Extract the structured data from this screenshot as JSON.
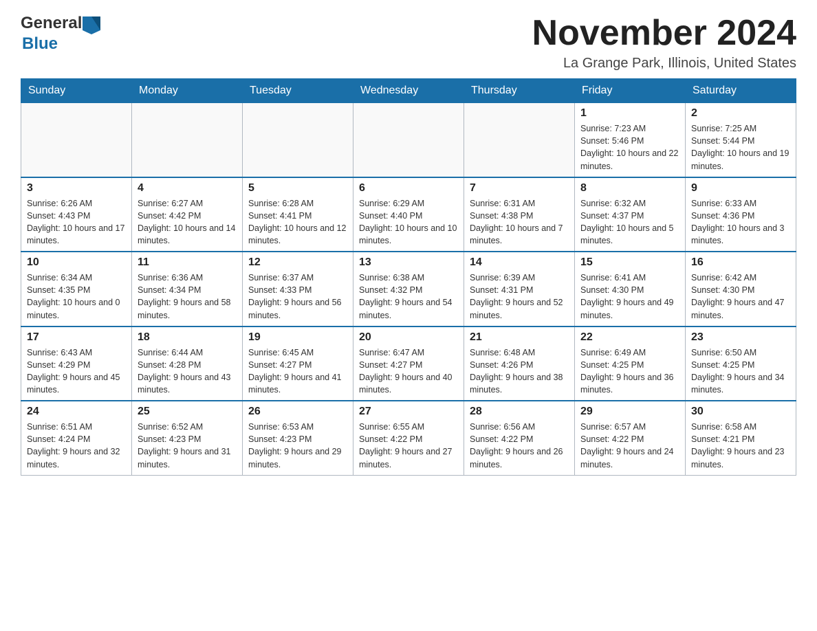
{
  "header": {
    "logo_general": "General",
    "logo_blue": "Blue",
    "month_title": "November 2024",
    "location": "La Grange Park, Illinois, United States"
  },
  "weekdays": [
    "Sunday",
    "Monday",
    "Tuesday",
    "Wednesday",
    "Thursday",
    "Friday",
    "Saturday"
  ],
  "weeks": [
    {
      "days": [
        {
          "num": "",
          "info": ""
        },
        {
          "num": "",
          "info": ""
        },
        {
          "num": "",
          "info": ""
        },
        {
          "num": "",
          "info": ""
        },
        {
          "num": "",
          "info": ""
        },
        {
          "num": "1",
          "info": "Sunrise: 7:23 AM\nSunset: 5:46 PM\nDaylight: 10 hours and 22 minutes."
        },
        {
          "num": "2",
          "info": "Sunrise: 7:25 AM\nSunset: 5:44 PM\nDaylight: 10 hours and 19 minutes."
        }
      ]
    },
    {
      "days": [
        {
          "num": "3",
          "info": "Sunrise: 6:26 AM\nSunset: 4:43 PM\nDaylight: 10 hours and 17 minutes."
        },
        {
          "num": "4",
          "info": "Sunrise: 6:27 AM\nSunset: 4:42 PM\nDaylight: 10 hours and 14 minutes."
        },
        {
          "num": "5",
          "info": "Sunrise: 6:28 AM\nSunset: 4:41 PM\nDaylight: 10 hours and 12 minutes."
        },
        {
          "num": "6",
          "info": "Sunrise: 6:29 AM\nSunset: 4:40 PM\nDaylight: 10 hours and 10 minutes."
        },
        {
          "num": "7",
          "info": "Sunrise: 6:31 AM\nSunset: 4:38 PM\nDaylight: 10 hours and 7 minutes."
        },
        {
          "num": "8",
          "info": "Sunrise: 6:32 AM\nSunset: 4:37 PM\nDaylight: 10 hours and 5 minutes."
        },
        {
          "num": "9",
          "info": "Sunrise: 6:33 AM\nSunset: 4:36 PM\nDaylight: 10 hours and 3 minutes."
        }
      ]
    },
    {
      "days": [
        {
          "num": "10",
          "info": "Sunrise: 6:34 AM\nSunset: 4:35 PM\nDaylight: 10 hours and 0 minutes."
        },
        {
          "num": "11",
          "info": "Sunrise: 6:36 AM\nSunset: 4:34 PM\nDaylight: 9 hours and 58 minutes."
        },
        {
          "num": "12",
          "info": "Sunrise: 6:37 AM\nSunset: 4:33 PM\nDaylight: 9 hours and 56 minutes."
        },
        {
          "num": "13",
          "info": "Sunrise: 6:38 AM\nSunset: 4:32 PM\nDaylight: 9 hours and 54 minutes."
        },
        {
          "num": "14",
          "info": "Sunrise: 6:39 AM\nSunset: 4:31 PM\nDaylight: 9 hours and 52 minutes."
        },
        {
          "num": "15",
          "info": "Sunrise: 6:41 AM\nSunset: 4:30 PM\nDaylight: 9 hours and 49 minutes."
        },
        {
          "num": "16",
          "info": "Sunrise: 6:42 AM\nSunset: 4:30 PM\nDaylight: 9 hours and 47 minutes."
        }
      ]
    },
    {
      "days": [
        {
          "num": "17",
          "info": "Sunrise: 6:43 AM\nSunset: 4:29 PM\nDaylight: 9 hours and 45 minutes."
        },
        {
          "num": "18",
          "info": "Sunrise: 6:44 AM\nSunset: 4:28 PM\nDaylight: 9 hours and 43 minutes."
        },
        {
          "num": "19",
          "info": "Sunrise: 6:45 AM\nSunset: 4:27 PM\nDaylight: 9 hours and 41 minutes."
        },
        {
          "num": "20",
          "info": "Sunrise: 6:47 AM\nSunset: 4:27 PM\nDaylight: 9 hours and 40 minutes."
        },
        {
          "num": "21",
          "info": "Sunrise: 6:48 AM\nSunset: 4:26 PM\nDaylight: 9 hours and 38 minutes."
        },
        {
          "num": "22",
          "info": "Sunrise: 6:49 AM\nSunset: 4:25 PM\nDaylight: 9 hours and 36 minutes."
        },
        {
          "num": "23",
          "info": "Sunrise: 6:50 AM\nSunset: 4:25 PM\nDaylight: 9 hours and 34 minutes."
        }
      ]
    },
    {
      "days": [
        {
          "num": "24",
          "info": "Sunrise: 6:51 AM\nSunset: 4:24 PM\nDaylight: 9 hours and 32 minutes."
        },
        {
          "num": "25",
          "info": "Sunrise: 6:52 AM\nSunset: 4:23 PM\nDaylight: 9 hours and 31 minutes."
        },
        {
          "num": "26",
          "info": "Sunrise: 6:53 AM\nSunset: 4:23 PM\nDaylight: 9 hours and 29 minutes."
        },
        {
          "num": "27",
          "info": "Sunrise: 6:55 AM\nSunset: 4:22 PM\nDaylight: 9 hours and 27 minutes."
        },
        {
          "num": "28",
          "info": "Sunrise: 6:56 AM\nSunset: 4:22 PM\nDaylight: 9 hours and 26 minutes."
        },
        {
          "num": "29",
          "info": "Sunrise: 6:57 AM\nSunset: 4:22 PM\nDaylight: 9 hours and 24 minutes."
        },
        {
          "num": "30",
          "info": "Sunrise: 6:58 AM\nSunset: 4:21 PM\nDaylight: 9 hours and 23 minutes."
        }
      ]
    }
  ]
}
